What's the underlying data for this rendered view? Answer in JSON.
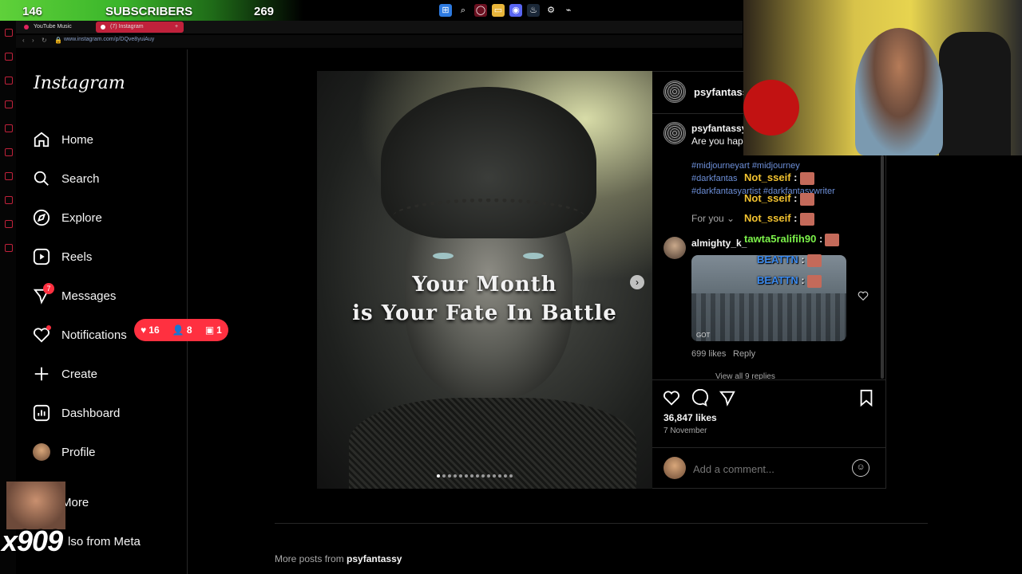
{
  "stream": {
    "sub_count_left": "146",
    "subscribers_label": "SUBSCRIBERS",
    "sub_count_right": "269"
  },
  "browser": {
    "tabs": [
      {
        "label": "YouTube Music"
      },
      {
        "label": "(7) Instagram"
      }
    ],
    "new_tab": "+",
    "url": "www.instagram.com/p/DQve8yuiAuy"
  },
  "instagram": {
    "logo": "Instagram",
    "nav": [
      {
        "label": "Home",
        "icon": "home-icon"
      },
      {
        "label": "Search",
        "icon": "search-icon"
      },
      {
        "label": "Explore",
        "icon": "compass-icon"
      },
      {
        "label": "Reels",
        "icon": "reels-icon"
      },
      {
        "label": "Messages",
        "icon": "messenger-icon",
        "badge": "7"
      },
      {
        "label": "Notifications",
        "icon": "heart-icon"
      },
      {
        "label": "Create",
        "icon": "plus-icon"
      },
      {
        "label": "Dashboard",
        "icon": "dashboard-icon"
      },
      {
        "label": "Profile",
        "icon": "profile-avatar"
      },
      {
        "label": "More",
        "icon": "menu-icon"
      },
      {
        "label": "lso from Meta",
        "icon": "meta-icon"
      }
    ],
    "notifications_pill": {
      "likes": "16",
      "follows": "8",
      "requests": "1"
    }
  },
  "post": {
    "title_line1": "Your Month",
    "title_line2": "is Your Fate In Battle",
    "author": "psyfantassy",
    "caption_author": "psyfantassy",
    "caption_text": "Are you happ",
    "hashtags_line1": "#midjourneyart #midjourney",
    "hashtags_line2": "#darkfantas",
    "hashtags_line3": "#darkfantasyartist #darkfantasywriter",
    "sort_label": "For you",
    "comment_author": "almighty_k_",
    "gif_watermark": "GOT",
    "comment_likes": "699 likes",
    "reply_label": "Reply",
    "view_replies": "View all 9 replies",
    "likes": "36,847 likes",
    "date": "7 November",
    "add_comment_placeholder": "Add a comment..."
  },
  "chat": [
    {
      "user": "Not_sseif",
      "color": "#f2c230"
    },
    {
      "user": "Not_sseif",
      "color": "#f2c230"
    },
    {
      "user": "Not_sseif",
      "color": "#f2c230"
    },
    {
      "user": "tawta5ralifih90",
      "color": "#7cf24a"
    },
    {
      "user": "BEATTN",
      "color": "#3c8bf0"
    },
    {
      "user": "BEATTN",
      "color": "#3c8bf0"
    }
  ],
  "chat_separator": ":",
  "bottom": {
    "more_posts_prefix": "More posts from",
    "more_posts_user": "psyfantassy"
  },
  "emote_counter": "x909",
  "colors": {
    "accent": "#ff3040",
    "link": "#6d8fd8",
    "sub_bar": "#3ab52a"
  }
}
